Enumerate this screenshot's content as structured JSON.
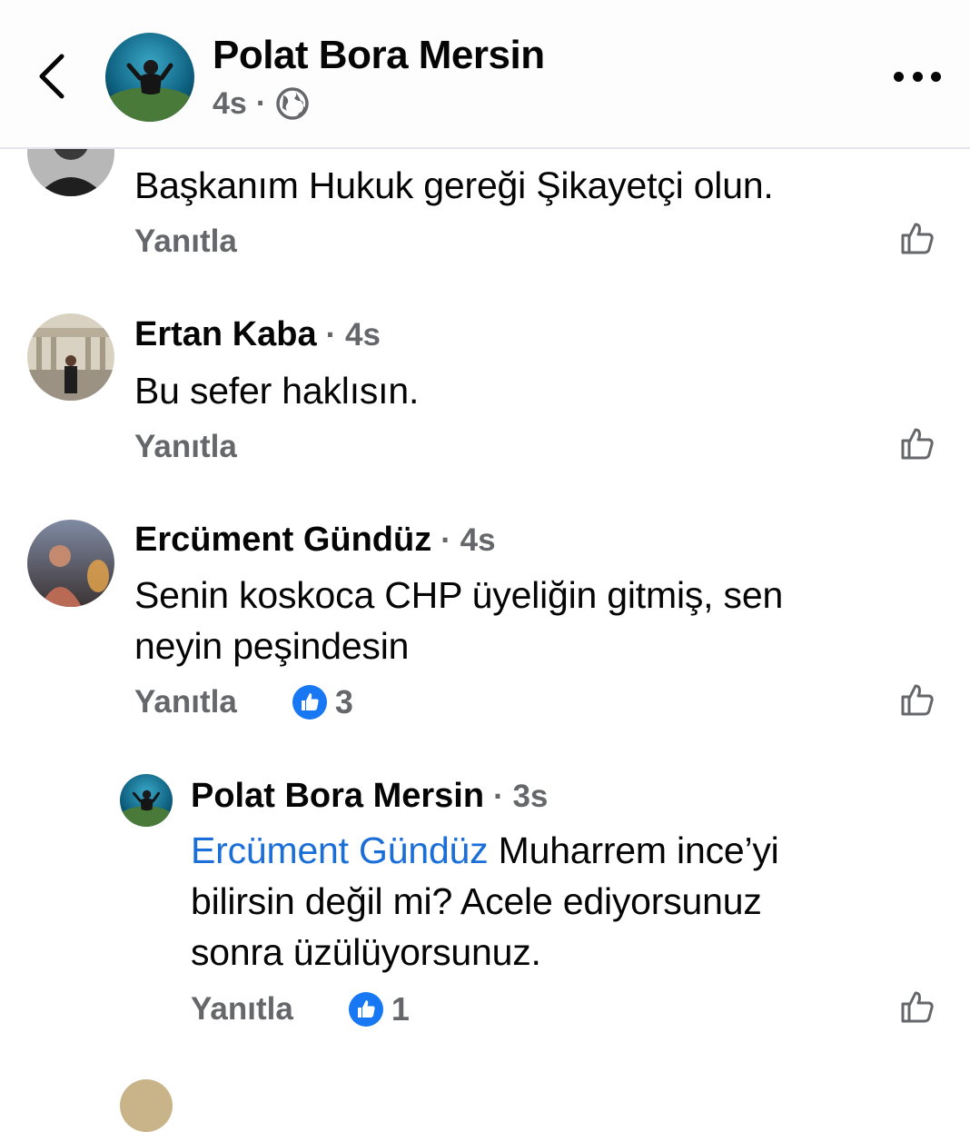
{
  "header": {
    "title": "Polat Bora Mersin",
    "time": "4s",
    "separator": "·",
    "icons": {
      "back": "chevron-left-icon",
      "privacy": "globe-icon",
      "more": "more-horizontal-icon"
    }
  },
  "comments": [
    {
      "author": "",
      "time": "",
      "text": "Başkanım Hukuk gereği Şikayetçi olun.",
      "reply_label": "Yanıtla"
    },
    {
      "author": "Ertan Kaba",
      "time": "· 4s",
      "text": "Bu sefer haklısın.",
      "reply_label": "Yanıtla"
    },
    {
      "author": "Ercüment Gündüz",
      "time": "· 4s",
      "text_line1": "Senin koskoca CHP üyeliğin gitmiş, sen",
      "text_line2": "neyin peşindesin",
      "reply_label": "Yanıtla",
      "reaction_count": "3"
    },
    {
      "author": "Polat Bora Mersin",
      "time": "· 3s",
      "mention": "Ercüment Gündüz",
      "text_line1": " Muharrem ince’yi",
      "text_line2": "bilirsin değil mi? Acele ediyorsunuz",
      "text_line3": "sonra üzülüyorsunuz.",
      "reply_label": "Yanıtla",
      "reaction_count": "1"
    }
  ],
  "colors": {
    "link_blue": "#1a6ed8",
    "like_badge": "#1877f2",
    "muted": "#65676b"
  }
}
